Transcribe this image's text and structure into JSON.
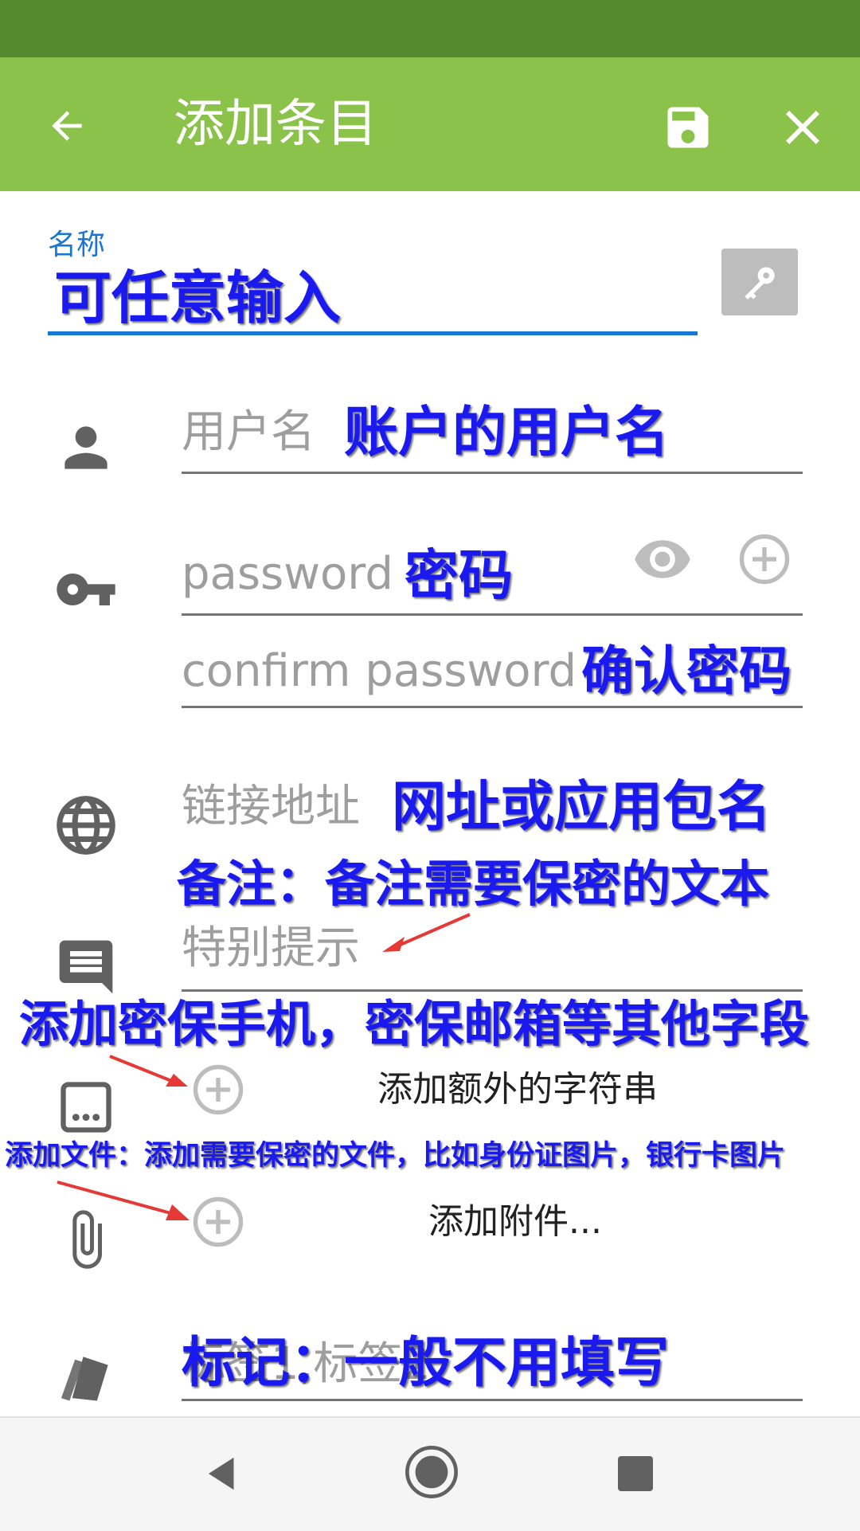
{
  "appbar": {
    "title": "添加条目",
    "back_icon": "arrow-back-icon",
    "save_icon": "save-icon",
    "close_icon": "close-icon"
  },
  "name_field": {
    "label": "名称",
    "annotation": "可任意输入",
    "generate_icon": "key-icon"
  },
  "username_field": {
    "placeholder": "用户名",
    "annotation": "账户的用户名",
    "icon": "person-icon"
  },
  "password_field": {
    "placeholder": "password",
    "annotation": "密码",
    "icon": "vpn-key-icon",
    "visibility_icon": "eye-icon",
    "add_icon": "add-circle-icon"
  },
  "confirm_field": {
    "placeholder": "confirm password",
    "annotation": "确认密码"
  },
  "url_field": {
    "placeholder": "链接地址",
    "annotation": "网址或应用包名",
    "icon": "globe-icon"
  },
  "notes_field": {
    "annotation": "备注：备注需要保密的文本",
    "placeholder": "特别提示",
    "icon": "comment-icon"
  },
  "extra_strings": {
    "annotation": "添加密保手机，密保邮箱等其他字段",
    "label": "添加额外的字符串",
    "icon": "more-box-icon"
  },
  "attachments": {
    "annotation": "添加文件：添加需要保密的文件，比如身份证图片，银行卡图片",
    "label": "添加附件...",
    "icon": "paperclip-icon"
  },
  "tags_field": {
    "placeholder": "标签1,标签2",
    "annotation": "标记：一般不用填写",
    "icon": "tags-icon"
  },
  "colors": {
    "statusbar": "#558b2f",
    "appbar": "#8bc34a",
    "accent": "#1976d2",
    "annotation": "#1a1af0",
    "arrow": "#e53935"
  }
}
